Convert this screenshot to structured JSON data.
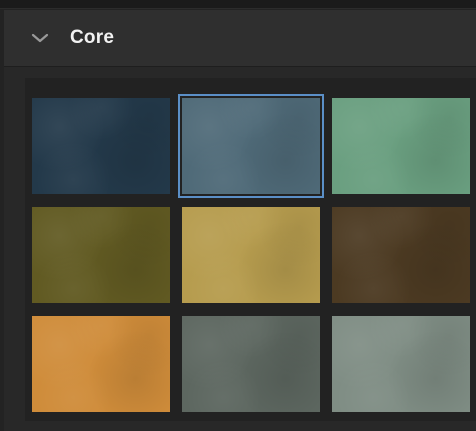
{
  "panel": {
    "title": "Core",
    "expanded": true,
    "toggle_icon": "chevron-down-icon"
  },
  "swatches": [
    {
      "name": "swatch-1",
      "color": "#23394a",
      "selected": false
    },
    {
      "name": "swatch-2",
      "color": "#4f6a78",
      "selected": true
    },
    {
      "name": "swatch-3",
      "color": "#6a9f80",
      "selected": false
    },
    {
      "name": "swatch-4",
      "color": "#615a22",
      "selected": false
    },
    {
      "name": "swatch-5",
      "color": "#b69c4e",
      "selected": false
    },
    {
      "name": "swatch-6",
      "color": "#4c3a22",
      "selected": false
    },
    {
      "name": "swatch-7",
      "color": "#cf8c3a",
      "selected": false
    },
    {
      "name": "swatch-8",
      "color": "#5d6760",
      "selected": false
    },
    {
      "name": "swatch-9",
      "color": "#7f8d84",
      "selected": false
    }
  ],
  "colors": {
    "selection_outline": "#5b8fc7",
    "header_bg": "#2f2f2f",
    "title_text": "#f2f2f2"
  }
}
